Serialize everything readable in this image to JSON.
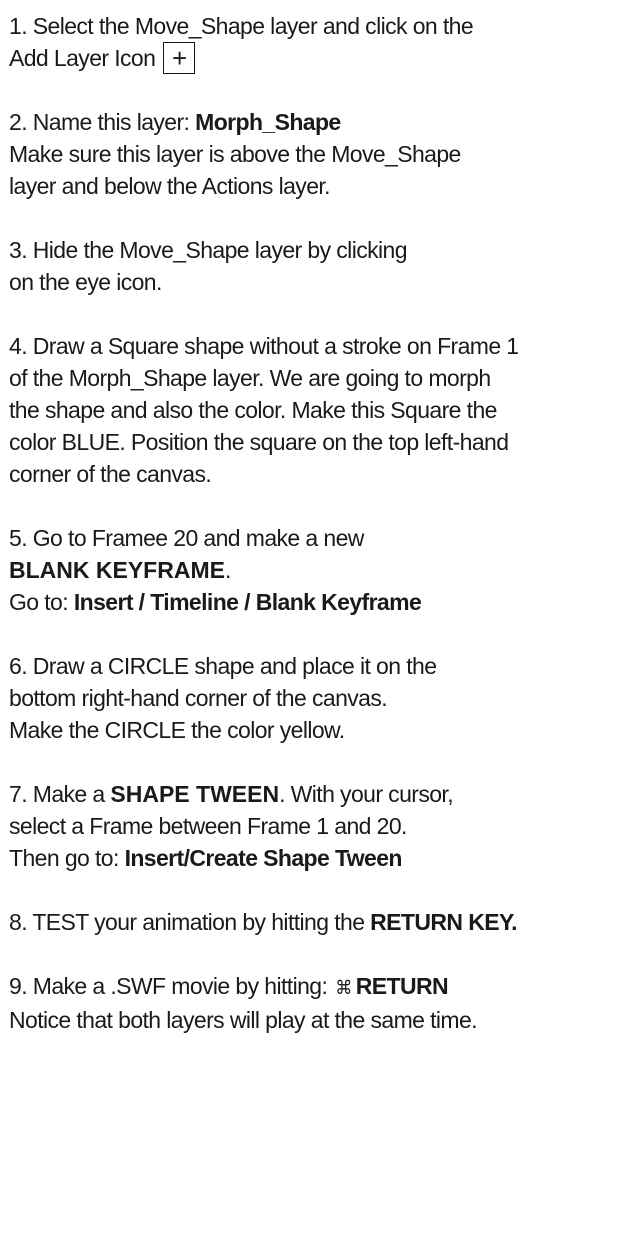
{
  "steps": [
    {
      "line1": "1. Select the  Move_Shape layer and click on the",
      "line2": "Add Layer Icon",
      "icon_glyph": "+"
    },
    {
      "prefix": "2. Name this layer: ",
      "bold": "Morph_Shape",
      "line2": "Make sure this layer is above the Move_Shape",
      "line3": "layer and below the Actions layer."
    },
    {
      "line1": "3. Hide the Move_Shape layer by clicking",
      "line2": "on the eye icon."
    },
    {
      "line1": "4. Draw a Square shape without a stroke on Frame 1",
      "line2": "of the Morph_Shape layer.  We are going to morph",
      "line3": "the shape and also the color. Make this Square the",
      "line4": "color BLUE. Position the square on the  top left-hand",
      "line5": "corner of the canvas."
    },
    {
      "line1": "5. Go to Framee 20 and make a new",
      "bold_wide": "BLANK KEYFRAME",
      "bold_wide_suffix": ".",
      "line3_prefix": "Go to: ",
      "line3_bold": "Insert / Timeline / Blank Keyframe"
    },
    {
      "line1": "6. Draw a CIRCLE shape and place it on the",
      "line2": "bottom right-hand corner of the canvas.",
      "line3": "Make the CIRCLE the color yellow."
    },
    {
      "prefix": "7. Make a ",
      "bold_wide": "SHAPE TWEEN",
      "suffix": ". With your cursor,",
      "line2": "select a Frame between Frame 1 and 20.",
      "line3_prefix": "Then go to: ",
      "line3_bold": "Insert/Create Shape Tween"
    },
    {
      "prefix": "8. TEST your animation by hitting the ",
      "bold": "RETURN KEY."
    },
    {
      "prefix": "9. Make a .SWF movie  by hitting:",
      "cmd_glyph": "⌘",
      "bold": "RETURN",
      "line2": "Notice that both layers will play at the same time."
    }
  ]
}
